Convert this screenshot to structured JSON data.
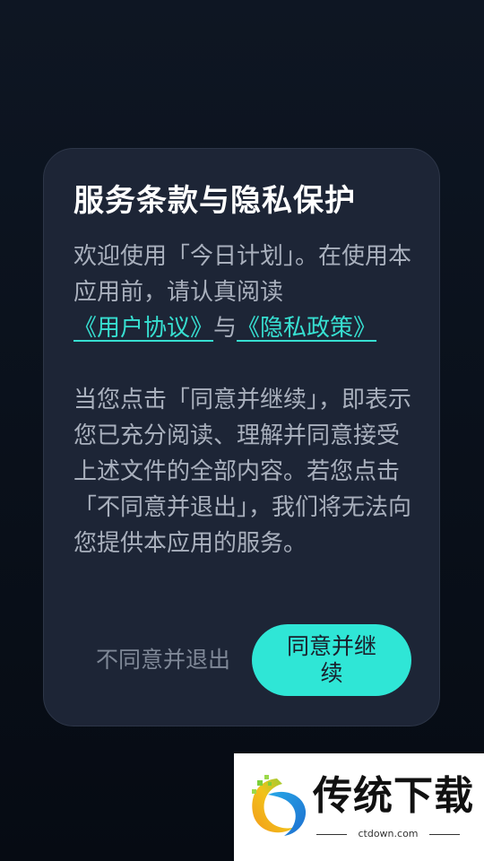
{
  "dialog": {
    "title": "服务条款与隐私保护",
    "para1_prefix": "欢迎使用「今日计划」。在使用本应用前，请认真阅读",
    "user_agreement_link": "《用户协议》",
    "connector": "与",
    "privacy_policy_link": "《隐私政策》",
    "para2": "当您点击「同意并继续」，即表示您已充分阅读、理解并同意接受上述文件的全部内容。若您点击「不同意并退出」，我们将无法向您提供本应用的服务。",
    "disagree_button": "不同意并退出",
    "agree_button": "同意并继续"
  },
  "watermark": {
    "brand": "传统下载",
    "url": "ctdown.com"
  },
  "colors": {
    "accent": "#2fe6d6",
    "link": "#37dfd1",
    "dialog_bg": "#1d2536",
    "page_bg": "#060b13"
  }
}
